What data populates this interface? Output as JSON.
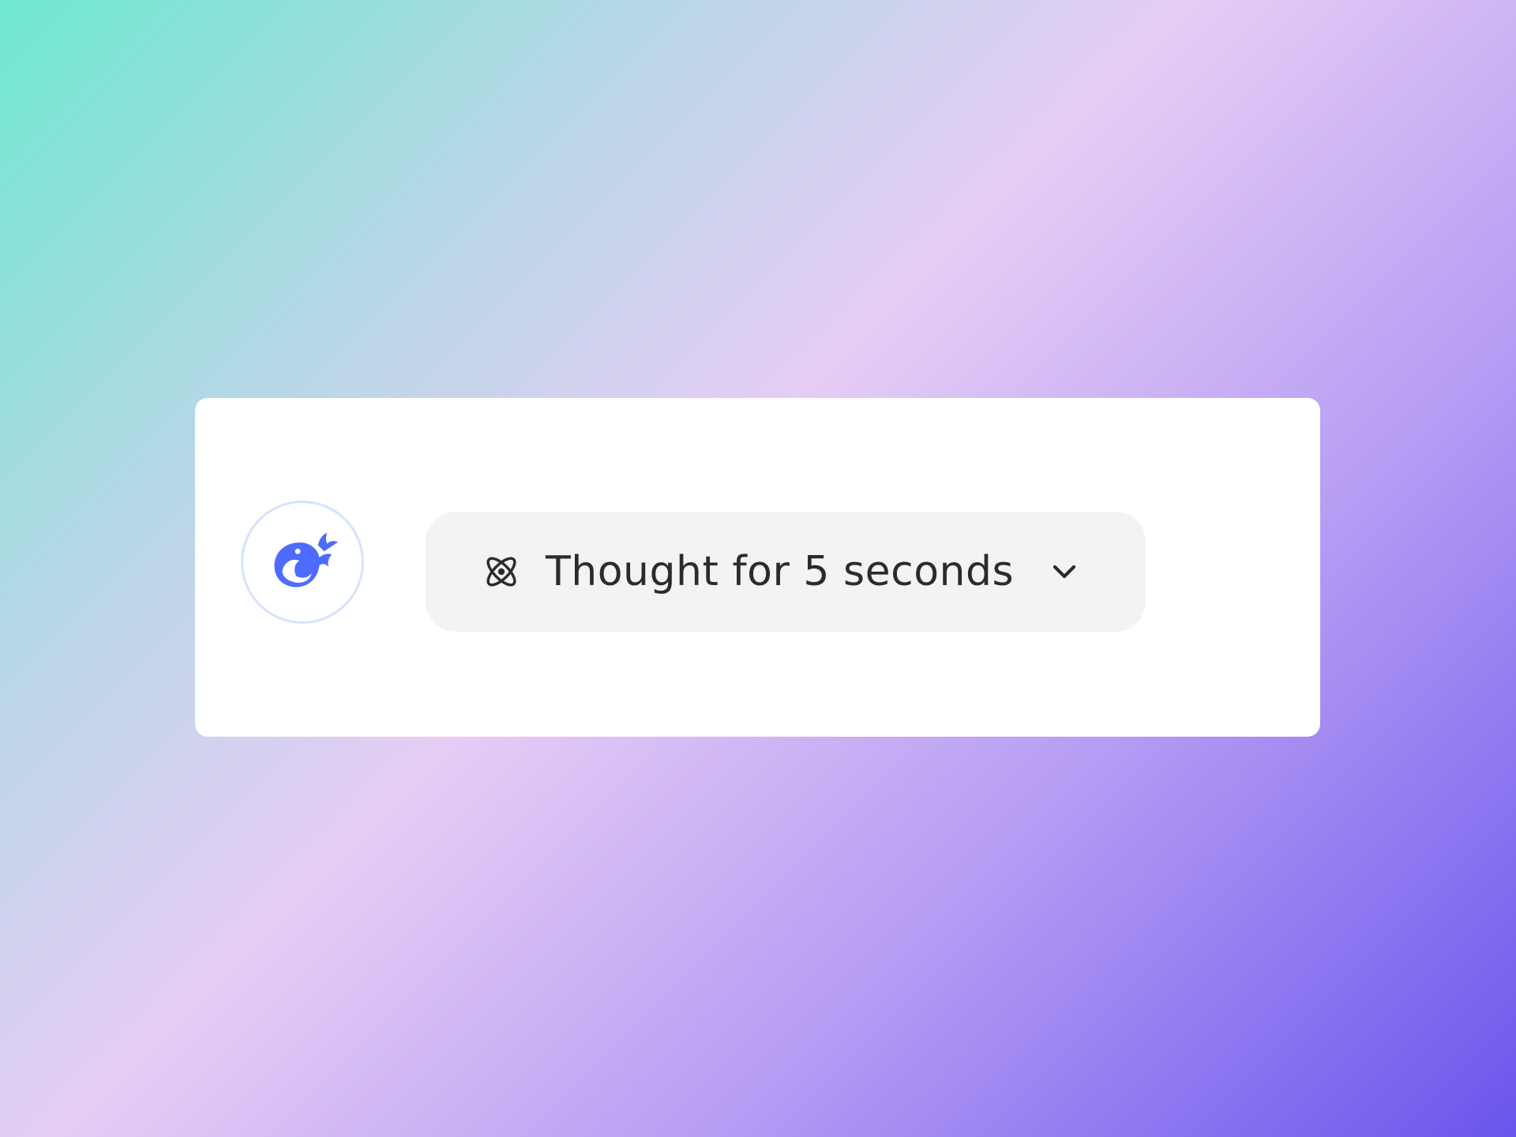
{
  "theme": {
    "accent": "#4d6bfe",
    "pill_background": "#f3f3f3",
    "text_color": "#2b2b2b"
  },
  "message": {
    "avatar_icon": "deepseek-whale-icon",
    "thinking": {
      "icon": "atom-icon",
      "label": "Thought for 5 seconds",
      "toggle_icon": "chevron-down-icon"
    }
  }
}
